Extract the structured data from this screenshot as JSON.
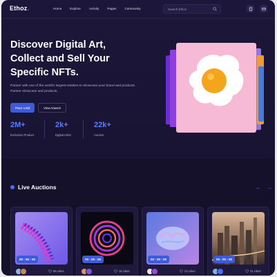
{
  "brand": {
    "name": "Ethoz",
    "dot": "."
  },
  "nav": {
    "links": [
      "Home",
      "Explore",
      "Activity",
      "Pages",
      "Community"
    ],
    "search_placeholder": "Search Ethoz",
    "icons": [
      "document-icon",
      "wallet-icon"
    ]
  },
  "hero": {
    "title": "Discover Digital Art, Collect and Sell Your Specific NFTs.",
    "subtitle": "Partner with one of the world's largest retailers to showcase your brand and products. Partner showcase and products.",
    "primary_button": "Place a Bid",
    "secondary_button": "View Artwork",
    "stats": [
      {
        "value": "2M+",
        "label": "Exclusive Product"
      },
      {
        "value": "2k+",
        "label": "Digital Artist"
      },
      {
        "value": "22k+",
        "label": "Auction"
      }
    ]
  },
  "auctions": {
    "title": "Live Auctions",
    "cards": [
      {
        "timer": "00 : 00 : 00",
        "likes": "96 Likes",
        "art": "purple-spiral-art"
      },
      {
        "timer": "00 : 00 : 00",
        "likes": "16 Likes",
        "art": "neon-swirl-art"
      },
      {
        "timer": "00 : 00 : 00",
        "likes": "22 Likes",
        "art": "glass-brain-art"
      },
      {
        "timer": "00 : 00 : 00",
        "likes": "31 Likes",
        "art": "city-skyline-photo"
      }
    ]
  },
  "colors": {
    "background": "#15112b",
    "accent": "#3b5bdb",
    "stat_value": "#5b7cff",
    "art_card": "#f6b9d6"
  }
}
